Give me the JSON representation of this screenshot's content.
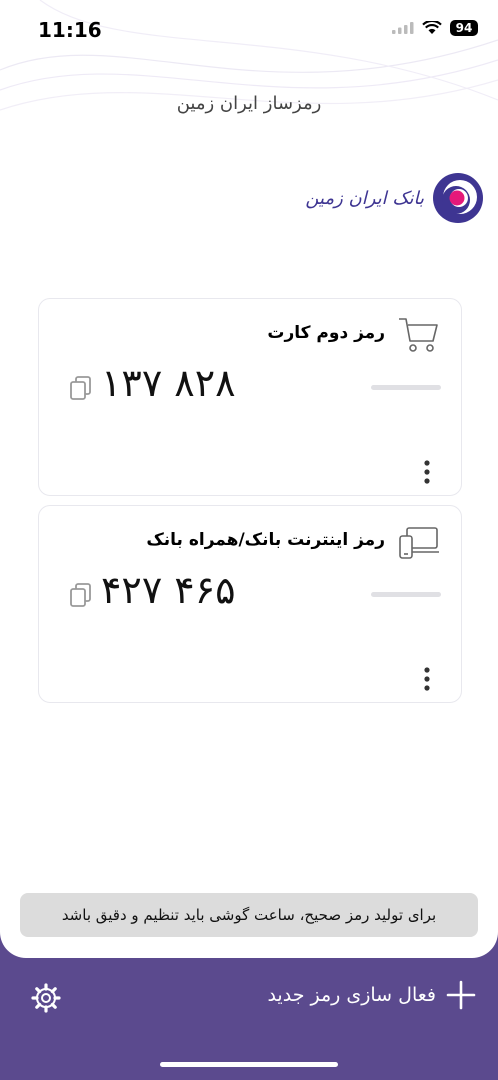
{
  "status_bar": {
    "time": "11:16",
    "battery": "94"
  },
  "app": {
    "title": "رمزساز ایران زمین",
    "logo_text": "بانک ایران زمین"
  },
  "cards": [
    {
      "title": "رمز دوم کارت",
      "code": "۱۳۷ ۸۲۸",
      "icon": "cart-icon",
      "progress": 0
    },
    {
      "title": "رمز اینترنت بانک/همراه بانک",
      "code": "۴۲۷ ۴۶۵",
      "icon": "devices-icon",
      "progress": 0
    }
  ],
  "notice": "برای تولید رمز صحیح، ساعت گوشی باید تنظیم و دقیق باشد",
  "bottom_bar": {
    "activate_label": "فعال سازی رمز جدید",
    "accent_color": "#5b4a8e"
  }
}
